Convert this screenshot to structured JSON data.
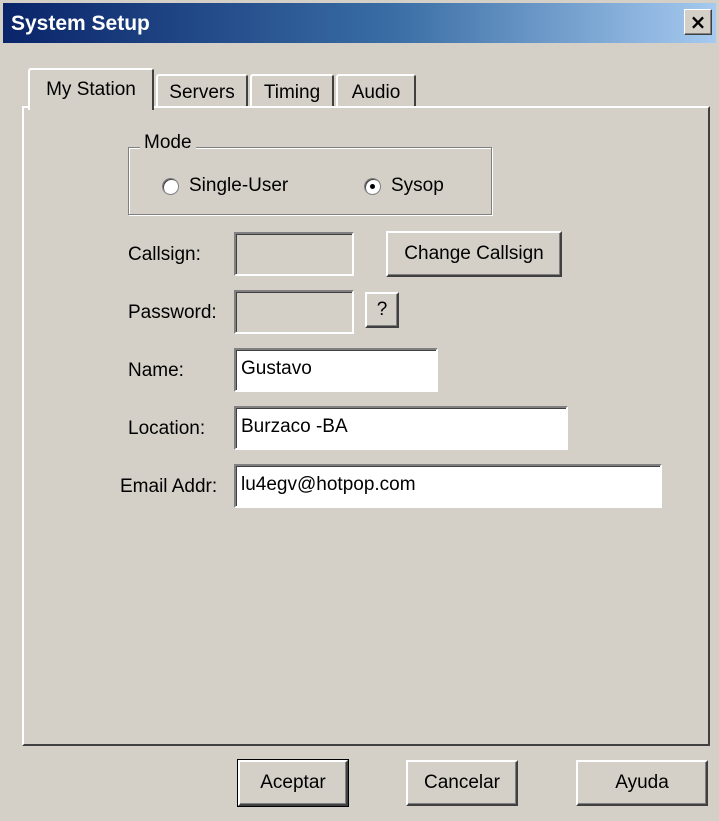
{
  "window": {
    "title": "System Setup",
    "close_glyph": "×"
  },
  "tabs": [
    {
      "label": "My Station",
      "active": true
    },
    {
      "label": "Servers",
      "active": false
    },
    {
      "label": "Timing",
      "active": false
    },
    {
      "label": "Audio",
      "active": false
    }
  ],
  "mode": {
    "group_label": "Mode",
    "options": [
      {
        "label": "Single-User",
        "selected": false
      },
      {
        "label": "Sysop",
        "selected": true
      }
    ]
  },
  "fields": {
    "callsign": {
      "label": "Callsign:",
      "value": ""
    },
    "password": {
      "label": "Password:",
      "value": ""
    },
    "name": {
      "label": "Name:",
      "value": "Gustavo"
    },
    "location": {
      "label": "Location:",
      "value": "Burzaco -BA"
    },
    "email": {
      "label": "Email Addr:",
      "value": "lu4egv@hotpop.com"
    }
  },
  "buttons": {
    "change_callsign": "Change Callsign",
    "password_help": "?",
    "ok": "Aceptar",
    "cancel": "Cancelar",
    "help": "Ayuda"
  }
}
